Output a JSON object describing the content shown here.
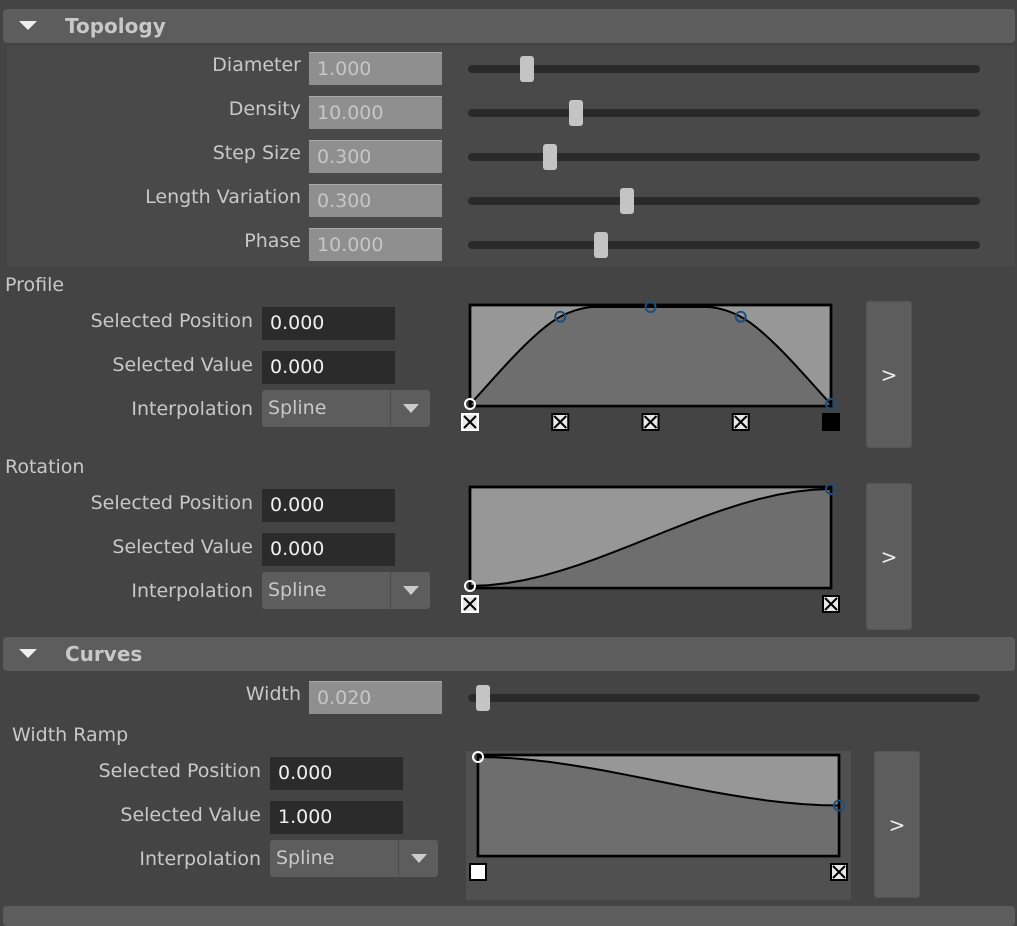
{
  "topology": {
    "title": "Topology",
    "expanded": true,
    "sliders": [
      {
        "label": "Diameter",
        "value": "1.000",
        "fraction": 0.115
      },
      {
        "label": "Density",
        "value": "10.000",
        "fraction": 0.21
      },
      {
        "label": "Step Size",
        "value": "0.300",
        "fraction": 0.16
      },
      {
        "label": "Length Variation",
        "value": "0.300",
        "fraction": 0.31
      },
      {
        "label": "Phase",
        "value": "10.000",
        "fraction": 0.26
      }
    ]
  },
  "profile": {
    "title": "Profile",
    "selected_position_label": "Selected Position",
    "selected_position": "0.000",
    "selected_value_label": "Selected Value",
    "selected_value": "0.000",
    "interpolation_label": "Interpolation",
    "interpolation": "Spline",
    "expand_label": ">",
    "points": [
      [
        0,
        0
      ],
      [
        0.25,
        0.9
      ],
      [
        0.5,
        1
      ],
      [
        0.75,
        0.9
      ],
      [
        1,
        0
      ]
    ],
    "selected_index": 0
  },
  "rotation": {
    "title": "Rotation",
    "selected_position_label": "Selected Position",
    "selected_position": "0.000",
    "selected_value_label": "Selected Value",
    "selected_value": "0.000",
    "interpolation_label": "Interpolation",
    "interpolation": "Spline",
    "expand_label": ">",
    "points": [
      [
        0,
        0
      ],
      [
        1,
        1
      ]
    ],
    "selected_index": 0
  },
  "curves": {
    "title": "Curves",
    "expanded": true,
    "width": {
      "label": "Width",
      "value": "0.020",
      "fraction": 0.03
    },
    "width_ramp": {
      "title": "Width Ramp",
      "selected_position_label": "Selected Position",
      "selected_position": "0.000",
      "selected_value_label": "Selected Value",
      "selected_value": "1.000",
      "interpolation_label": "Interpolation",
      "interpolation": "Spline",
      "expand_label": ">",
      "points": [
        [
          0,
          1
        ],
        [
          1,
          0.5
        ]
      ],
      "selected_index": 0
    }
  },
  "colors": {
    "background": "#444444",
    "header": "#5d5d5d",
    "ramp_bg": "#979797",
    "ramp_fill": "#6e6e6e",
    "point_marker": "#1f4e7a"
  }
}
